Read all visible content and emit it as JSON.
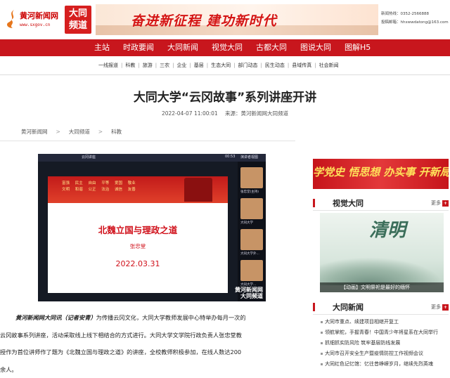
{
  "site": {
    "logo_name": "黄河新闻网",
    "logo_url": "www.sxgov.cn",
    "channel_label": "大同频道"
  },
  "banner": {
    "slogan": "奋进新征程 建功新时代"
  },
  "contact": {
    "line1": "新闻热线：0352-2566888",
    "line2": "投稿邮箱：hhxwwdatong@163.com"
  },
  "nav": {
    "items": [
      "主站",
      "时政要闻",
      "大同新闻",
      "视觉大同",
      "古都大同",
      "图说大同",
      "图解H5"
    ]
  },
  "subnav": {
    "items": [
      "一线报道",
      "科教",
      "旅游",
      "三农",
      "企业",
      "基层",
      "生态大同",
      "部门动态",
      "民生动态",
      "县域传真",
      "社会新闻"
    ]
  },
  "article": {
    "title": "大同大学“云冈故事”系列讲座开讲",
    "date": "2022-04-07 11:00:01",
    "source": "来源：黄河新闻网大同频道",
    "breadcrumb": [
      "黄河新闻网",
      "大同频道",
      "科教"
    ],
    "lead": "黄河新闻网大同讯（记者安青）",
    "paragraph_lines": [
      "为传播云冈文化，大同大学教师发展中心特举办每月一次的",
      "云冈故事系列讲座，活动采取线上线下相结合的方式进行。大同大学文学院行政负责人张忠堂教",
      "授作为首位讲师作了题为《北魏立国与理政之道》的讲座，全校教师积极参加，在线人数达200",
      "余人。"
    ]
  },
  "screenshot": {
    "meeting_title": "云冈讲座",
    "time": "00:53",
    "panel_header": "演讲者视图",
    "slide_words_line1": "富强 民主 自由 平等 爱国 敬业",
    "slide_words_line2": "文明 和谐 公正 法治 诚信 友善",
    "lecture_title": "北魏立国与理政之道",
    "speaker": "张忠堂",
    "lecture_date": "2022.03.31",
    "participants": [
      "张忠堂(主持)",
      "大同大学",
      "大同大学外...",
      "大同大学..."
    ],
    "watermark_line1": "黄河新闻网",
    "watermark_line2": "大同频道"
  },
  "sidebar": {
    "banner_text": "学党史 悟思想 办实事 开新局",
    "visual": {
      "title": "视觉大同",
      "more": "更多",
      "feature_text": "清明",
      "feature_caption": "【动画】文明祭祀是最好的缅怀"
    },
    "news": {
      "title": "大同新闻",
      "more": "更多",
      "items": [
        "大同市重点、续建项目相继开复工",
        "领航掌舵，手握青春！中国青少年将星系在大同举行",
        "抓细抓实防风险 筑牢基层防线发展",
        "大同市召开安全生产暨疫情防控工作视频会议",
        "大同红色记忆馆：忆往昔峥嵘岁月，继续先烈英魂"
      ]
    }
  },
  "colors": {
    "brand_red": "#c8161d",
    "slide_red": "#d0101a"
  }
}
